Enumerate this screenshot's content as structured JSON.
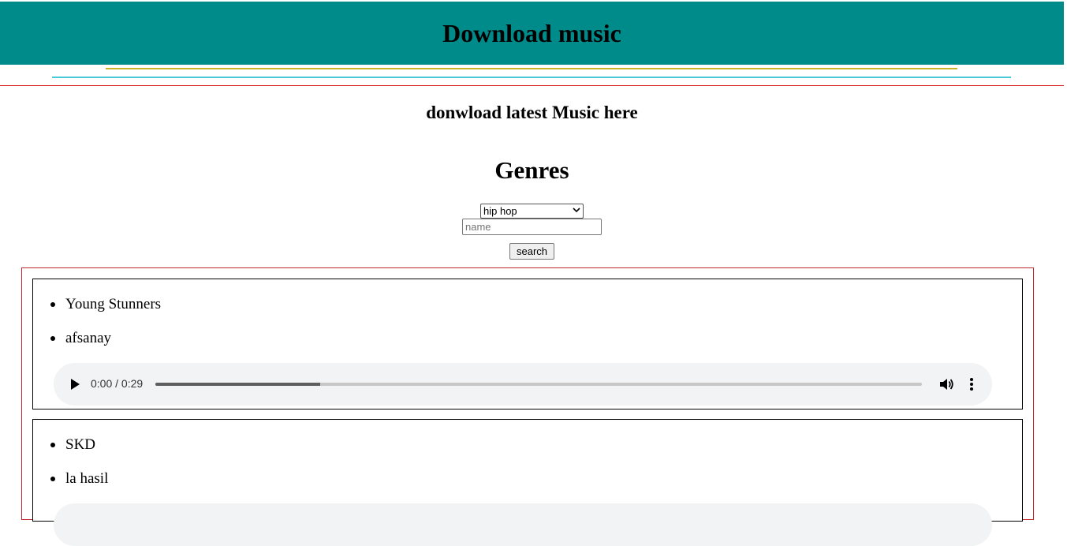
{
  "header": {
    "title": "Download music"
  },
  "subtitle": "donwload latest Music here",
  "genres": {
    "title": "Genres",
    "selected": "hip hop",
    "name_placeholder": "name",
    "search_label": "search"
  },
  "tracks": [
    {
      "artist": "Young Stunners",
      "title": "afsanay",
      "player": {
        "time": "0:00 / 0:29",
        "progress": 0.215
      }
    },
    {
      "artist": "SKD",
      "title": "la hasil"
    }
  ],
  "colors": {
    "header_bg": "#008b8b",
    "outer_border": "#c1272d"
  },
  "icons": [
    "play-icon",
    "volume-icon",
    "more-options-icon",
    "chevron-down-icon"
  ]
}
